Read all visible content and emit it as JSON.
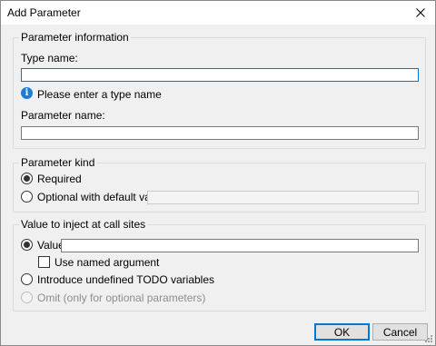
{
  "window": {
    "title": "Add Parameter"
  },
  "parameter_information": {
    "legend": "Parameter information",
    "type_name_label": "Type name:",
    "type_name_value": "",
    "info_message": "Please enter a type name",
    "parameter_name_label": "Parameter name:",
    "parameter_name_value": ""
  },
  "parameter_kind": {
    "legend": "Parameter kind",
    "required_label": "Required",
    "optional_label": "Optional with default value:",
    "default_value": "",
    "selected": "required"
  },
  "value_to_inject": {
    "legend": "Value to inject at call sites",
    "value_label": "Value:",
    "value": "",
    "use_named_argument_label": "Use named argument",
    "use_named_argument_checked": false,
    "todo_label": "Introduce undefined TODO variables",
    "omit_label": "Omit (only for optional parameters)",
    "selected": "value"
  },
  "buttons": {
    "ok": "OK",
    "cancel": "Cancel"
  },
  "icons": {
    "close": "close-icon",
    "info": "info-icon",
    "grip": "resize-grip-icon"
  },
  "colors": {
    "accent": "#0078d7",
    "info": "#1c7cd6"
  }
}
